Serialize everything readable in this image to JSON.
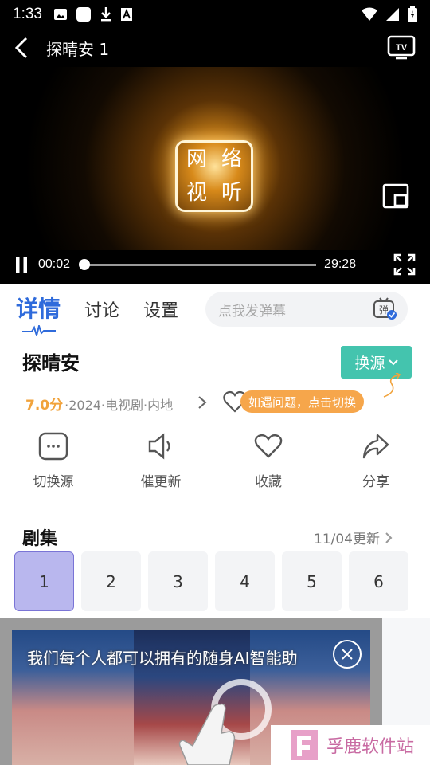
{
  "status_bar": {
    "time": "1:33"
  },
  "player": {
    "title": "探晴安 1",
    "logo_chars": [
      "网",
      "络",
      "视",
      "听"
    ],
    "current_time": "00:02",
    "total_time": "29:28",
    "progress": 0.001
  },
  "tabs": [
    {
      "label": "详情",
      "active": true
    },
    {
      "label": "讨论",
      "active": false
    },
    {
      "label": "设置",
      "active": false
    }
  ],
  "danmu": {
    "placeholder": "点我发弹幕",
    "icon_label": "弹"
  },
  "detail": {
    "show_title": "探晴安",
    "source_button": "换源",
    "score": "7.0分",
    "meta": "·2024·电视剧·内地",
    "tip": "如遇问题，点击切换"
  },
  "actions": [
    {
      "label": "切换源",
      "icon": "switch-source-icon"
    },
    {
      "label": "催更新",
      "icon": "speaker-icon"
    },
    {
      "label": "收藏",
      "icon": "heart-icon"
    },
    {
      "label": "分享",
      "icon": "share-icon"
    }
  ],
  "episodes": {
    "header": "剧集",
    "update": "11/04更新",
    "items": [
      "1",
      "2",
      "3",
      "4",
      "5",
      "6"
    ],
    "active_index": 0
  },
  "ad": {
    "text": "我们每个人都可以拥有的随身AI智能助"
  },
  "watermark": {
    "text": "孚鹿软件站"
  },
  "colors": {
    "accent": "#2f6bdb",
    "source_button": "#44c4ae",
    "score": "#f1a33c",
    "tip": "#f6a64b",
    "episode_active": "#b9b7ee"
  }
}
